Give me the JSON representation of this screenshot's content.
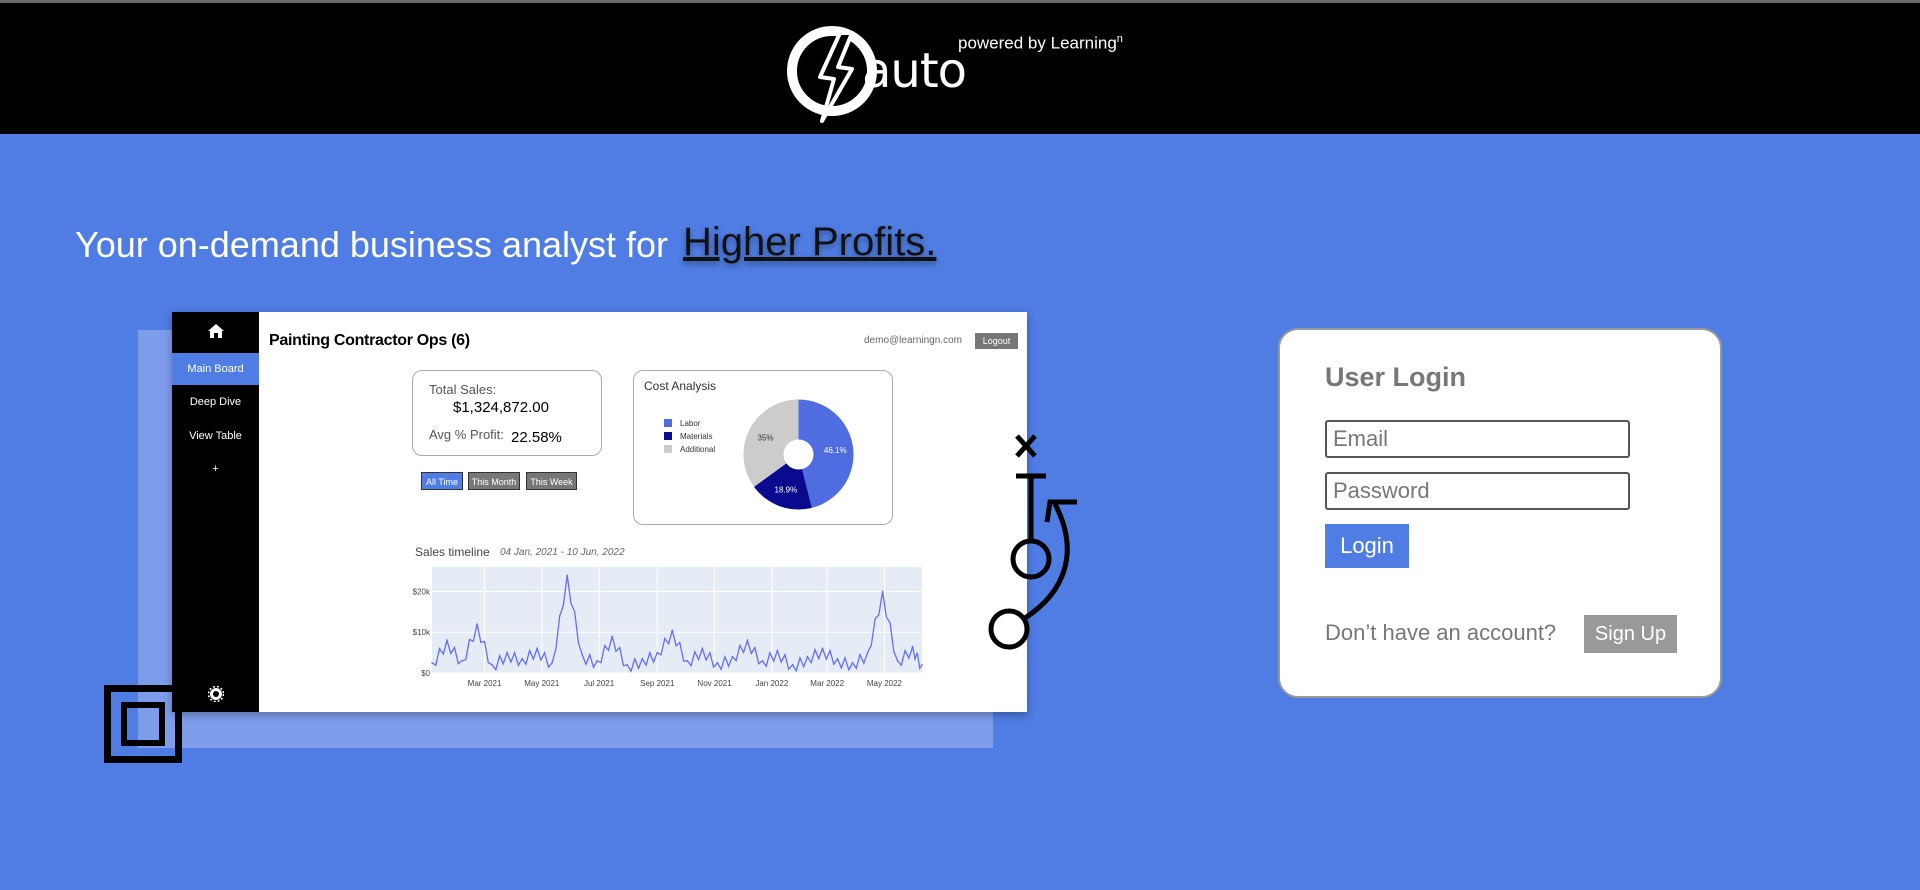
{
  "brand": {
    "logo_text": "auto",
    "powered_by": "powered by Learning",
    "powered_sup": "n"
  },
  "hero": {
    "headline": "Your on-demand business analyst for",
    "highlight": "Higher Profits."
  },
  "mockup": {
    "nav": [
      "Main Board",
      "Deep Dive",
      "View Table",
      "+"
    ],
    "title": "Painting Contractor Ops (6)",
    "email": "demo@learningn.com",
    "logout": "Logout",
    "total_sales_label": "Total Sales:",
    "total_sales_value": "$1,324,872.00",
    "avg_profit_label": "Avg % Profit:",
    "avg_profit_value": "22.58%",
    "time_filters": [
      "All Time",
      "This Month",
      "This Week"
    ],
    "cost_title": "Cost Analysis",
    "timeline_title": "Sales timeline",
    "timeline_range": "04 Jan, 2021 - 10 Jun, 2022"
  },
  "chart_data": [
    {
      "type": "pie",
      "title": "Cost Analysis",
      "labels": [
        "Labor",
        "Materials",
        "Additional"
      ],
      "values": [
        46.1,
        18.9,
        35.0
      ],
      "value_labels": [
        "46.1%",
        "18.9%",
        "35%"
      ],
      "colors": [
        "#4f6de0",
        "#0a0a8f",
        "#cccccc"
      ],
      "legend": "left"
    },
    {
      "type": "line",
      "title": "Sales timeline",
      "subtitle": "04 Jan, 2021 - 10 Jun, 2022",
      "x_ticks": [
        "Mar 2021",
        "May 2021",
        "Jul 2021",
        "Sep 2021",
        "Nov 2021",
        "Jan 2022",
        "Mar 2022",
        "May 2022"
      ],
      "y_ticks": [
        "$0",
        "$10k",
        "$20k"
      ],
      "ylim": [
        0,
        26000
      ],
      "x_range": [
        "2021-01-04",
        "2022-06-10"
      ],
      "line_color": "#636efa",
      "grid": true,
      "x": [
        "2021-01-04",
        "2021-01-20",
        "2021-02-05",
        "2021-02-21",
        "2021-03-09",
        "2021-03-25",
        "2021-04-10",
        "2021-04-26",
        "2021-05-12",
        "2021-05-28",
        "2021-06-13",
        "2021-06-29",
        "2021-07-15",
        "2021-07-31",
        "2021-08-16",
        "2021-09-01",
        "2021-09-17",
        "2021-10-03",
        "2021-10-19",
        "2021-11-04",
        "2021-11-20",
        "2021-12-06",
        "2021-12-22",
        "2022-01-07",
        "2022-01-23",
        "2022-02-08",
        "2022-02-24",
        "2022-03-12",
        "2022-03-28",
        "2022-04-13",
        "2022-04-29",
        "2022-05-15",
        "2022-05-31",
        "2022-06-10"
      ],
      "y": [
        2500,
        8000,
        3000,
        12000,
        2000,
        5000,
        3500,
        6000,
        2500,
        24000,
        4500,
        3000,
        9000,
        2000,
        3500,
        5000,
        10500,
        3000,
        6000,
        2500,
        4000,
        8000,
        3000,
        5500,
        2000,
        4000,
        6000,
        3500,
        2500,
        5000,
        20000,
        3000,
        6500,
        2000
      ]
    }
  ],
  "login": {
    "title": "User Login",
    "email_placeholder": "Email",
    "password_placeholder": "Password",
    "login_label": "Login",
    "no_account": "Don’t have an account?",
    "signup_label": "Sign Up"
  },
  "colors": {
    "accent": "#4f7de3",
    "header_bg": "#000000"
  }
}
